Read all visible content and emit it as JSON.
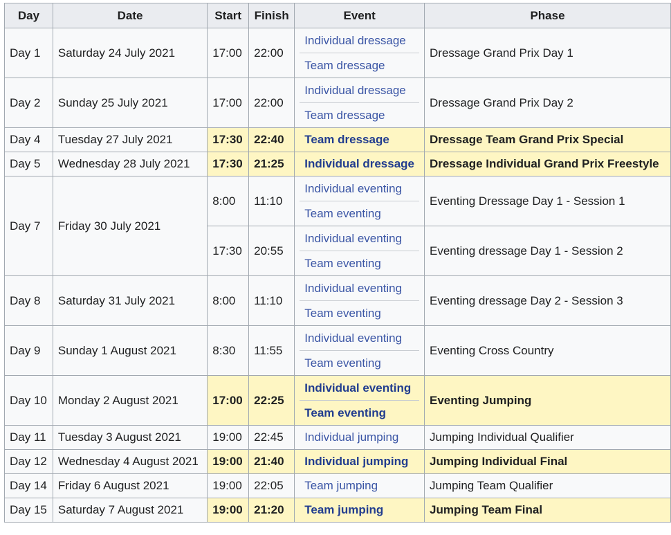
{
  "headers": [
    "Day",
    "Date",
    "Start",
    "Finish",
    "Event",
    "Phase"
  ],
  "rows": [
    {
      "day": "Day 1",
      "date": "Saturday 24 July 2021",
      "sessions": [
        {
          "start": "17:00",
          "finish": "22:00",
          "events": [
            "Individual dressage",
            "Team dressage"
          ],
          "phase": "Dressage Grand Prix Day 1",
          "highlight": false
        }
      ]
    },
    {
      "day": "Day 2",
      "date": "Sunday 25 July 2021",
      "sessions": [
        {
          "start": "17:00",
          "finish": "22:00",
          "events": [
            "Individual dressage",
            "Team dressage"
          ],
          "phase": "Dressage Grand Prix Day 2",
          "highlight": false
        }
      ]
    },
    {
      "day": "Day 4",
      "date": "Tuesday 27 July 2021",
      "sessions": [
        {
          "start": "17:30",
          "finish": "22:40",
          "events": [
            "Team dressage"
          ],
          "phase": "Dressage Team Grand Prix Special",
          "highlight": true
        }
      ]
    },
    {
      "day": "Day 5",
      "date": "Wednesday 28 July 2021",
      "sessions": [
        {
          "start": "17:30",
          "finish": "21:25",
          "events": [
            "Individual dressage"
          ],
          "phase": "Dressage Individual Grand Prix Freestyle",
          "highlight": true
        }
      ]
    },
    {
      "day": "Day 7",
      "date": "Friday 30 July 2021",
      "sessions": [
        {
          "start": "8:00",
          "finish": "11:10",
          "events": [
            "Individual eventing",
            "Team eventing"
          ],
          "phase": "Eventing Dressage Day 1 - Session 1",
          "highlight": false
        },
        {
          "start": "17:30",
          "finish": "20:55",
          "events": [
            "Individual eventing",
            "Team eventing"
          ],
          "phase": "Eventing dressage Day 1 - Session 2",
          "highlight": false
        }
      ]
    },
    {
      "day": "Day 8",
      "date": "Saturday 31 July 2021",
      "sessions": [
        {
          "start": "8:00",
          "finish": "11:10",
          "events": [
            "Individual eventing",
            "Team eventing"
          ],
          "phase": "Eventing dressage Day 2 - Session 3",
          "highlight": false
        }
      ]
    },
    {
      "day": "Day 9",
      "date": "Sunday 1 August 2021",
      "sessions": [
        {
          "start": "8:30",
          "finish": "11:55",
          "events": [
            "Individual eventing",
            "Team eventing"
          ],
          "phase": "Eventing Cross Country",
          "highlight": false
        }
      ]
    },
    {
      "day": "Day 10",
      "date": "Monday 2 August 2021",
      "sessions": [
        {
          "start": "17:00",
          "finish": "22:25",
          "events": [
            "Individual eventing",
            "Team eventing"
          ],
          "phase": "Eventing Jumping",
          "highlight": true
        }
      ]
    },
    {
      "day": "Day 11",
      "date": "Tuesday 3 August 2021",
      "sessions": [
        {
          "start": "19:00",
          "finish": "22:45",
          "events": [
            "Individual jumping"
          ],
          "phase": "Jumping Individual Qualifier",
          "highlight": false
        }
      ]
    },
    {
      "day": "Day 12",
      "date": "Wednesday 4 August 2021",
      "sessions": [
        {
          "start": "19:00",
          "finish": "21:40",
          "events": [
            "Individual jumping"
          ],
          "phase": "Jumping Individual Final",
          "highlight": true
        }
      ]
    },
    {
      "day": "Day 14",
      "date": "Friday 6 August 2021",
      "sessions": [
        {
          "start": "19:00",
          "finish": "22:05",
          "events": [
            "Team jumping"
          ],
          "phase": "Jumping Team Qualifier",
          "highlight": false
        }
      ]
    },
    {
      "day": "Day 15",
      "date": "Saturday 7 August 2021",
      "sessions": [
        {
          "start": "19:00",
          "finish": "21:20",
          "events": [
            "Team jumping"
          ],
          "phase": "Jumping Team Final",
          "highlight": true
        }
      ]
    }
  ]
}
